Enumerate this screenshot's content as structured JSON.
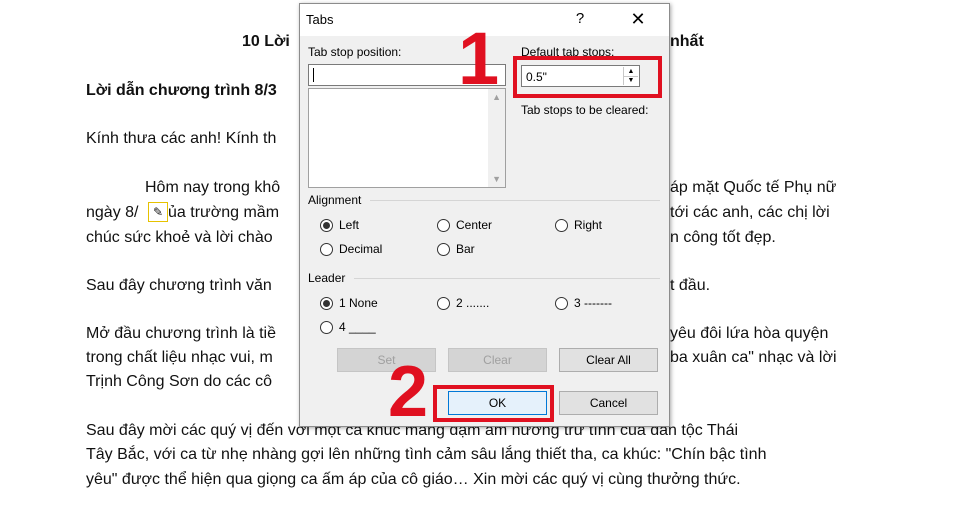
{
  "document": {
    "lines": [
      "10 Lời",
      "nhất",
      "Lời dẫn chương trình 8/3",
      "Kính thưa các anh! Kính th",
      "Hôm nay trong khô",
      "áp mặt Quốc tế Phụ nữ",
      "ngày 8/",
      "ủa trường mầm",
      "tới các anh, các chị lời",
      "chúc sức khoẻ và lời chào",
      "n công tốt đẹp.",
      "Sau đây chương trình văn",
      "t đầu.",
      "Mở đầu chương trình là tiề",
      "yêu đôi lứa hòa quyện",
      "trong chất liệu nhạc vui, m",
      "ba xuân ca\" nhạc và lời",
      "Trịnh Công Sơn do các cô",
      "Sau đây mời các quý vị đến với một ca khúc mang đậm âm hưởng trữ tình của dân tộc Thái",
      "Tây Bắc, với ca từ nhẹ nhàng gợi lên những tình cảm sâu lắng thiết tha, ca khúc: \"Chín bậc tình",
      "yêu\" được thể hiện qua giọng ca ấm áp của cô giáo… Xin mời các quý vị cùng thưởng thức."
    ]
  },
  "dialog": {
    "title": "Tabs",
    "help": "?",
    "close": "✕",
    "tab_stop_position_label": "Tab stop position:",
    "tab_stop_position_value": "",
    "default_tab_stops_label": "Default tab stops:",
    "default_tab_stops_value": "0.5\"",
    "tab_stops_cleared_label": "Tab stops to be cleared:",
    "alignment_label": "Alignment",
    "alignment": [
      {
        "label": "Left",
        "checked": true
      },
      {
        "label": "Center",
        "checked": false
      },
      {
        "label": "Right",
        "checked": false
      },
      {
        "label": "Decimal",
        "checked": false
      },
      {
        "label": "Bar",
        "checked": false
      }
    ],
    "leader_label": "Leader",
    "leader": [
      {
        "label": "1 None",
        "checked": true
      },
      {
        "label": "2 .......",
        "checked": false
      },
      {
        "label": "3 -------",
        "checked": false
      },
      {
        "label": "4 ____",
        "checked": false
      }
    ],
    "buttons": {
      "set": "Set",
      "clear": "Clear",
      "clear_all": "Clear All",
      "ok": "OK",
      "cancel": "Cancel"
    }
  },
  "annotations": {
    "step1": "1",
    "step2": "2",
    "color": "#e01020"
  }
}
